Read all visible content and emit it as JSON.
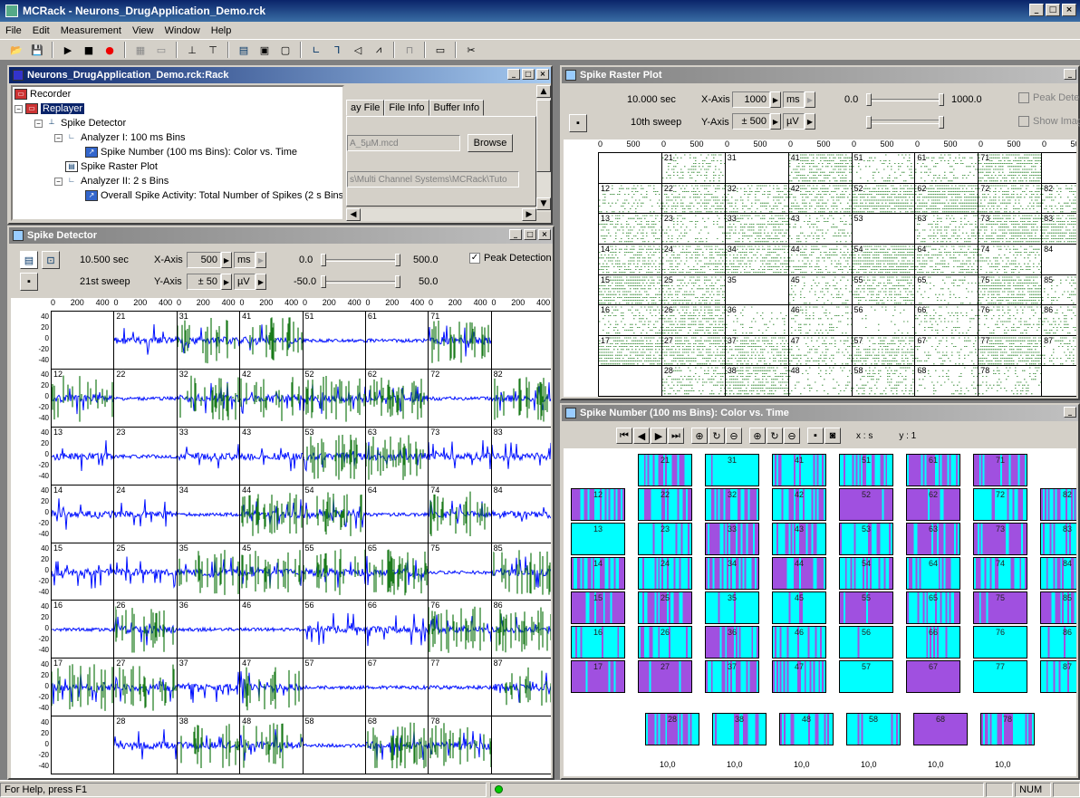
{
  "app": {
    "title": "MCRack - Neurons_DrugApplication_Demo.rck",
    "menu": [
      "File",
      "Edit",
      "Measurement",
      "View",
      "Window",
      "Help"
    ]
  },
  "toolbar_icons": [
    "open-icon",
    "save-icon",
    "play-icon",
    "stop-icon",
    "record-icon",
    "grid-icon",
    "monitor-icon",
    "spike-detector-icon",
    "spike-sorter-icon",
    "raster-icon",
    "display-icon",
    "display2-icon",
    "analyzer-icon",
    "filter-icon",
    "sound-icon",
    "trigger-icon",
    "hist-icon",
    "window-icon",
    "cut-icon"
  ],
  "rack": {
    "title": "Neurons_DrugApplication_Demo.rck:Rack",
    "tree": [
      "Recorder",
      "Replayer",
      "Spike Detector",
      "Analyzer I: 100 ms Bins",
      "Spike Number (100 ms Bins): Color vs. Time",
      "Spike Raster Plot",
      "Analyzer II: 2 s Bins",
      "Overall Spike Activity: Total Number of Spikes (2 s Bins)"
    ],
    "tabs": [
      "ay File",
      "File Info",
      "Buffer Info"
    ],
    "file_field": "A_5µM.mcd",
    "browse": "Browse",
    "path_field": "s\\Multi Channel Systems\\MCRack\\Tuto"
  },
  "detector": {
    "title": "Spike Detector",
    "time": "10.500 sec",
    "sweep": "21st sweep",
    "xaxis_label": "X-Axis",
    "xaxis_val": "500",
    "xunit": "ms",
    "yaxis_label": "Y-Axis",
    "yaxis_val": "± 50",
    "yunit": "µV",
    "x_min": "0.0",
    "x_max": "500.0",
    "y_min": "-50.0",
    "y_max": "50.0",
    "peak": "Peak Detection",
    "x_ticks": [
      "0",
      "200",
      "400",
      "0",
      "200",
      "400",
      "0",
      "200",
      "400",
      "0",
      "200",
      "400",
      "0",
      "200",
      "400",
      "0",
      "200",
      "400",
      "0",
      "200",
      "400",
      "0",
      "200",
      "400"
    ],
    "y_ticks": [
      "40",
      "20",
      "0",
      "-20",
      "-40"
    ],
    "channels": [
      [
        "",
        "21",
        "31",
        "41",
        "51",
        "61",
        "71",
        ""
      ],
      [
        "12",
        "22",
        "32",
        "42",
        "52",
        "62",
        "72",
        "82"
      ],
      [
        "13",
        "23",
        "33",
        "43",
        "53",
        "63",
        "73",
        "83"
      ],
      [
        "14",
        "24",
        "34",
        "44",
        "54",
        "64",
        "74",
        "84"
      ],
      [
        "15",
        "25",
        "35",
        "45",
        "55",
        "65",
        "75",
        "85"
      ],
      [
        "16",
        "26",
        "36",
        "46",
        "56",
        "66",
        "76",
        "86"
      ],
      [
        "17",
        "27",
        "37",
        "47",
        "57",
        "67",
        "77",
        "87"
      ],
      [
        "",
        "28",
        "38",
        "48",
        "58",
        "68",
        "78",
        ""
      ]
    ]
  },
  "raster": {
    "title": "Spike Raster Plot",
    "time": "10.000 sec",
    "sweep": "10th sweep",
    "xaxis_label": "X-Axis",
    "xaxis_val": "1000",
    "xunit": "ms",
    "yaxis_label": "Y-Axis",
    "yaxis_val": "± 500",
    "yunit": "µV",
    "x_min": "0.0",
    "x_max": "1000.0",
    "peak": "Peak Dete",
    "show": "Show Imag",
    "x_ticks": [
      "0",
      "500",
      "0",
      "500",
      "0",
      "500",
      "0",
      "500",
      "0",
      "500",
      "0",
      "500",
      "0",
      "500",
      "0",
      "50"
    ]
  },
  "spikenum": {
    "title": "Spike Number (100 ms Bins): Color vs. Time",
    "xs": "x : s",
    "y1": "y : 1",
    "bottom_tick": "10,0",
    "colors": {
      "cyan": "#00ffff",
      "purple": "#a050e0"
    }
  },
  "status": {
    "help": "For Help, press F1",
    "num": "NUM"
  }
}
